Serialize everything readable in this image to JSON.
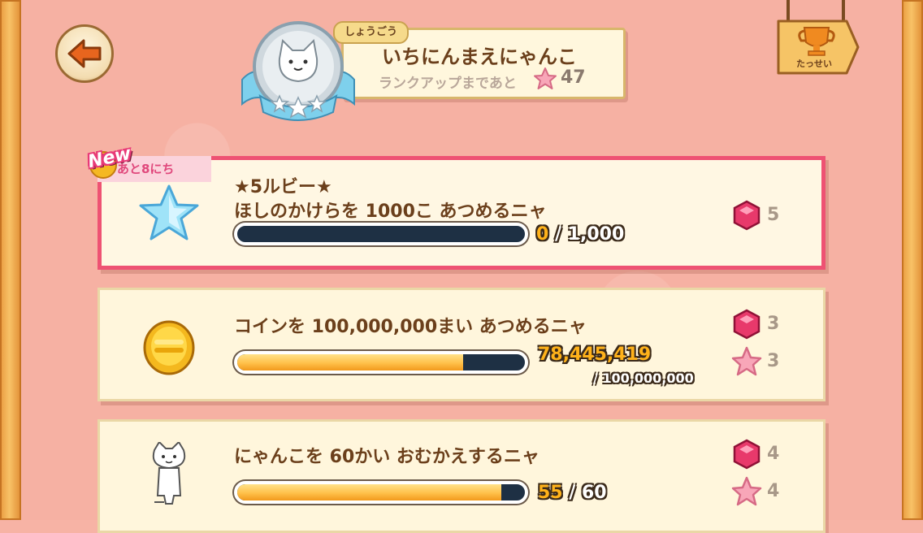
{
  "header": {
    "title_tag": "しょうごう",
    "title": "いちにんまえにゃんこ",
    "rankup_label": "ランクアップまであと",
    "rankup_count": "47",
    "achievements_label": "たっせい"
  },
  "missions": [
    {
      "is_new": true,
      "new_label": "New",
      "date_label": "あと8にち",
      "title_line1": "★5ルビー★",
      "title_line2": "ほしのかけらを 1000こ あつめるニャ",
      "current": "0",
      "target": "/ 1,000",
      "progress": 0.0,
      "rewards": [
        {
          "type": "ruby",
          "count": "5"
        }
      ]
    },
    {
      "title_line1": "コインを 100,000,000まい あつめるニャ",
      "current": "78,445,419",
      "target": "/ 100,000,000",
      "progress": 0.78445419,
      "rewards": [
        {
          "type": "ruby",
          "count": "3"
        },
        {
          "type": "star",
          "count": "3"
        }
      ]
    },
    {
      "title_line1": "にゃんこを 60かい おむかえするニャ",
      "current": "55",
      "target": "/ 60",
      "progress": 0.9167,
      "rewards": [
        {
          "type": "ruby",
          "count": "4"
        },
        {
          "type": "star",
          "count": "4"
        }
      ]
    }
  ],
  "icons": {
    "back": "back-arrow-icon",
    "rank": "cat-medal-icon",
    "trophy": "trophy-icon",
    "ruby": "ruby-icon",
    "star_reward": "pink-star-icon",
    "mission1": "blue-star-icon",
    "mission2": "gold-coin-icon",
    "mission3": "white-cat-icon"
  },
  "colors": {
    "background": "#f6b1a3",
    "new_border": "#ee5273",
    "bar_fill": "#ffc04a",
    "bar_empty": "#1e3044"
  }
}
